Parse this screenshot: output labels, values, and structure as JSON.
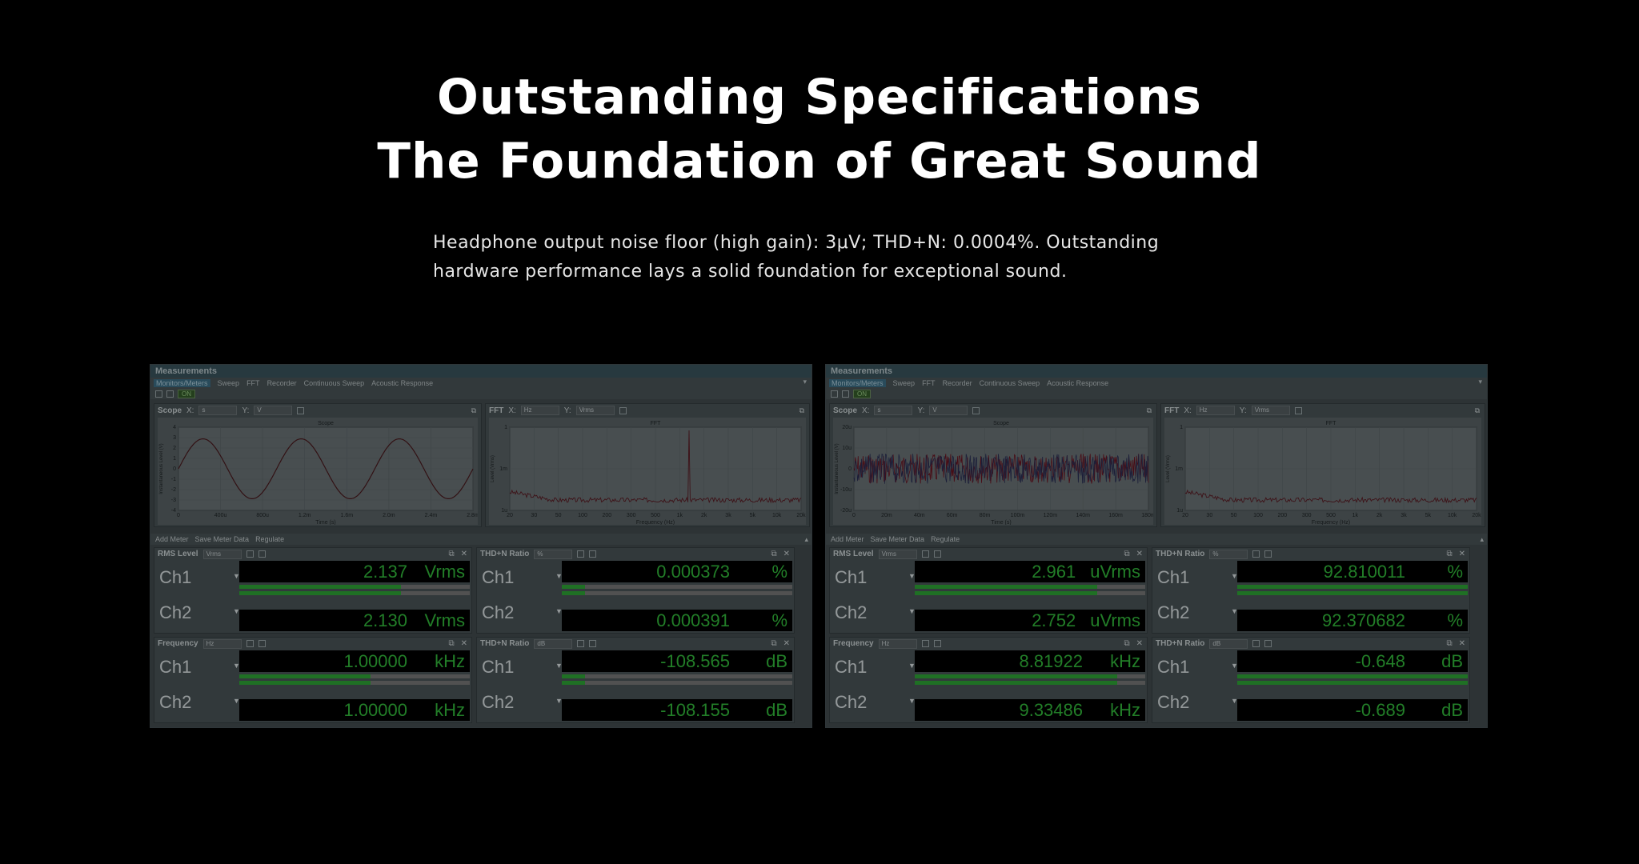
{
  "hero": {
    "title_line1": "Outstanding Specifications",
    "title_line2": "The Foundation of Great Sound",
    "subtitle_line1": "Headphone output noise floor (high gain): 3μV; THD+N: 0.0004%. Outstanding",
    "subtitle_line2": "hardware performance lays a solid foundation for exceptional sound."
  },
  "windows": [
    {
      "title": "Measurements",
      "tabs": [
        "Monitors/Meters",
        "Sweep",
        "FFT",
        "Recorder",
        "Continuous Sweep",
        "Acoustic Response"
      ],
      "on_label": "ON",
      "scope": {
        "label": "Scope",
        "x_unit": "s",
        "y_unit": "V",
        "plot_title": "Scope",
        "x_axis": "Time (s)",
        "y_axis": "Instantaneous Level (V)",
        "x_ticks": [
          "0",
          "400u",
          "800u",
          "1.2m",
          "1.6m",
          "2.0m",
          "2.4m",
          "2.8m"
        ],
        "y_ticks": [
          "4",
          "3",
          "2",
          "1",
          "0",
          "-1",
          "-2",
          "-3",
          "-4"
        ]
      },
      "fft": {
        "label": "FFT",
        "x_unit": "Hz",
        "y_unit": "Vrms",
        "plot_title": "FFT",
        "x_axis": "Frequency (Hz)",
        "y_axis": "Level (Vrms)",
        "x_ticks": [
          "20",
          "30",
          "50",
          "100",
          "200",
          "300",
          "500",
          "1k",
          "2k",
          "3k",
          "5k",
          "10k",
          "20k"
        ],
        "y_ticks": [
          "1",
          "1m",
          "1u"
        ]
      },
      "meter_toolbar": {
        "add": "Add Meter",
        "save": "Save Meter Data",
        "regulate": "Regulate"
      },
      "meters": [
        {
          "title": "RMS Level",
          "unit_select": "Vrms",
          "rows": [
            {
              "ch": "Ch1",
              "value": "2.137",
              "unit": "Vrms",
              "bar": 0.7
            },
            {
              "ch": "Ch2",
              "value": "2.130",
              "unit": "Vrms",
              "bar": 0.7
            }
          ]
        },
        {
          "title": "THD+N Ratio",
          "unit_select": "%",
          "rows": [
            {
              "ch": "Ch1",
              "value": "0.000373",
              "unit": "%",
              "bar": 0.1
            },
            {
              "ch": "Ch2",
              "value": "0.000391",
              "unit": "%",
              "bar": 0.1
            }
          ]
        },
        {
          "title": "Frequency",
          "unit_select": "Hz",
          "rows": [
            {
              "ch": "Ch1",
              "value": "1.00000",
              "unit": "kHz",
              "bar": 0.57
            },
            {
              "ch": "Ch2",
              "value": "1.00000",
              "unit": "kHz",
              "bar": 0.57
            }
          ]
        },
        {
          "title": "THD+N Ratio",
          "unit_select": "dB",
          "rows": [
            {
              "ch": "Ch1",
              "value": "-108.565",
              "unit": "dB",
              "bar": 0.1
            },
            {
              "ch": "Ch2",
              "value": "-108.155",
              "unit": "dB",
              "bar": 0.1
            }
          ]
        }
      ]
    },
    {
      "title": "Measurements",
      "tabs": [
        "Monitors/Meters",
        "Sweep",
        "FFT",
        "Recorder",
        "Continuous Sweep",
        "Acoustic Response"
      ],
      "on_label": "ON",
      "scope": {
        "label": "Scope",
        "x_unit": "s",
        "y_unit": "V",
        "plot_title": "Scope",
        "x_axis": "Time (s)",
        "y_axis": "Instantaneous Level (V)",
        "x_ticks": [
          "0",
          "20m",
          "40m",
          "60m",
          "80m",
          "100m",
          "120m",
          "140m",
          "160m",
          "180m"
        ],
        "y_ticks": [
          "20u",
          "10u",
          "0",
          "-10u",
          "-20u"
        ]
      },
      "fft": {
        "label": "FFT",
        "x_unit": "Hz",
        "y_unit": "Vrms",
        "plot_title": "FFT",
        "x_axis": "Frequency (Hz)",
        "y_axis": "Level (Vrms)",
        "x_ticks": [
          "20",
          "30",
          "50",
          "100",
          "200",
          "300",
          "500",
          "1k",
          "2k",
          "3k",
          "5k",
          "10k",
          "20k"
        ],
        "y_ticks": [
          "1",
          "1m",
          "1u"
        ]
      },
      "meter_toolbar": {
        "add": "Add Meter",
        "save": "Save Meter Data",
        "regulate": "Regulate"
      },
      "meters": [
        {
          "title": "RMS Level",
          "unit_select": "Vrms",
          "rows": [
            {
              "ch": "Ch1",
              "value": "2.961",
              "unit": "uVrms",
              "bar": 0.79
            },
            {
              "ch": "Ch2",
              "value": "2.752",
              "unit": "uVrms",
              "bar": 0.79
            }
          ]
        },
        {
          "title": "THD+N Ratio",
          "unit_select": "%",
          "rows": [
            {
              "ch": "Ch1",
              "value": "92.810011",
              "unit": "%",
              "bar": 1.0
            },
            {
              "ch": "Ch2",
              "value": "92.370682",
              "unit": "%",
              "bar": 1.0
            }
          ]
        },
        {
          "title": "Frequency",
          "unit_select": "Hz",
          "rows": [
            {
              "ch": "Ch1",
              "value": "8.81922",
              "unit": "kHz",
              "bar": 0.88
            },
            {
              "ch": "Ch2",
              "value": "9.33486",
              "unit": "kHz",
              "bar": 0.88
            }
          ]
        },
        {
          "title": "THD+N Ratio",
          "unit_select": "dB",
          "rows": [
            {
              "ch": "Ch1",
              "value": "-0.648",
              "unit": "dB",
              "bar": 1.0
            },
            {
              "ch": "Ch2",
              "value": "-0.689",
              "unit": "dB",
              "bar": 1.0
            }
          ]
        }
      ]
    }
  ]
}
